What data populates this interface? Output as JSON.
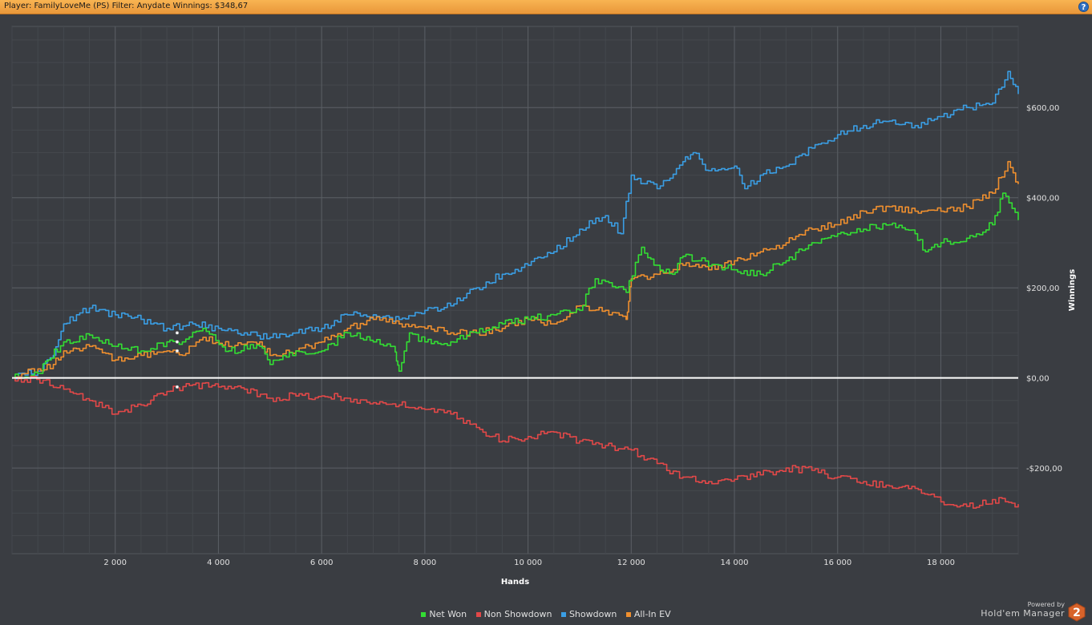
{
  "titlebar": {
    "text": "Player: FamilyLoveMe (PS) Filter: Anydate Winnings: $348,67",
    "help_label": "?"
  },
  "branding": {
    "powered_by": "Powered by",
    "product": "Hold'em Manager",
    "logo_label": "2"
  },
  "colors": {
    "background": "#3a3d42",
    "titlebar": "#f0a445",
    "grid": "#52565c",
    "zero_line": "#ffffff",
    "net_won": "#33dd33",
    "non_showdown": "#e24848",
    "showdown": "#3a9ee4",
    "all_in_ev": "#ef8f2e"
  },
  "chart_data": {
    "type": "line",
    "xlabel": "Hands",
    "ylabel": "Winnings",
    "xlim": [
      0,
      19500
    ],
    "ylim": [
      -390,
      780
    ],
    "x_ticks": [
      2000,
      4000,
      6000,
      8000,
      10000,
      12000,
      14000,
      16000,
      18000
    ],
    "x_tick_labels": [
      "2 000",
      "4 000",
      "6 000",
      "8 000",
      "10 000",
      "12 000",
      "14 000",
      "16 000",
      "18 000"
    ],
    "y_ticks": [
      -200,
      0,
      200,
      400,
      600
    ],
    "y_tick_labels": [
      "-$200,00",
      "$0,00",
      "$200,00",
      "$400,00",
      "$600,00"
    ],
    "grid": true,
    "legend_position": "bottom-center",
    "series": [
      {
        "name": "Net Won",
        "color": "#33dd33",
        "x": [
          0,
          500,
          700,
          1000,
          1500,
          2000,
          2500,
          3000,
          3300,
          3700,
          4200,
          4800,
          5000,
          5500,
          6000,
          6500,
          7000,
          7400,
          7500,
          7700,
          8000,
          8500,
          9000,
          9500,
          10000,
          10500,
          11000,
          11300,
          11700,
          11900,
          12200,
          12500,
          12800,
          13000,
          13300,
          13700,
          14000,
          14500,
          15000,
          15500,
          16000,
          16500,
          17000,
          17500,
          17700,
          18000,
          18500,
          19000,
          19200,
          19500
        ],
        "y": [
          0,
          10,
          40,
          80,
          95,
          70,
          60,
          80,
          80,
          110,
          60,
          70,
          30,
          60,
          60,
          100,
          80,
          70,
          15,
          100,
          80,
          80,
          100,
          120,
          130,
          140,
          150,
          220,
          200,
          190,
          290,
          250,
          230,
          270,
          260,
          250,
          240,
          230,
          260,
          300,
          320,
          330,
          340,
          320,
          280,
          300,
          310,
          340,
          410,
          350
        ]
      },
      {
        "name": "Non Showdown",
        "color": "#e24848",
        "x": [
          0,
          600,
          1000,
          1500,
          2000,
          2500,
          3000,
          3500,
          4000,
          4500,
          5000,
          5500,
          6000,
          6500,
          7000,
          7500,
          8000,
          8500,
          9000,
          9500,
          10000,
          10500,
          11000,
          11500,
          12000,
          12500,
          13000,
          13500,
          14000,
          14500,
          15000,
          15500,
          16000,
          16500,
          17000,
          17500,
          18000,
          18500,
          19000,
          19500
        ],
        "y": [
          0,
          -5,
          -25,
          -50,
          -80,
          -60,
          -30,
          -15,
          -20,
          -25,
          -45,
          -40,
          -40,
          -45,
          -55,
          -60,
          -70,
          -80,
          -110,
          -140,
          -130,
          -120,
          -140,
          -150,
          -160,
          -190,
          -220,
          -230,
          -225,
          -215,
          -200,
          -205,
          -220,
          -230,
          -240,
          -245,
          -275,
          -285,
          -270,
          -280
        ]
      },
      {
        "name": "Showdown",
        "color": "#3a9ee4",
        "x": [
          0,
          500,
          800,
          1000,
          1500,
          2000,
          2500,
          3000,
          3500,
          4000,
          4500,
          5000,
          5500,
          6000,
          6500,
          7000,
          7500,
          8000,
          8500,
          9000,
          9500,
          10000,
          10500,
          11000,
          11500,
          11800,
          12000,
          12500,
          13000,
          13200,
          13500,
          14000,
          14200,
          14500,
          15000,
          15500,
          16000,
          16500,
          17000,
          17500,
          18000,
          18500,
          19000,
          19300,
          19500
        ],
        "y": [
          0,
          15,
          50,
          120,
          155,
          140,
          130,
          110,
          120,
          110,
          100,
          90,
          100,
          110,
          140,
          140,
          130,
          150,
          160,
          200,
          230,
          250,
          280,
          330,
          360,
          320,
          450,
          420,
          480,
          500,
          460,
          470,
          420,
          450,
          470,
          510,
          540,
          560,
          570,
          560,
          580,
          600,
          610,
          680,
          630
        ]
      },
      {
        "name": "All-In EV",
        "color": "#ef8f2e",
        "x": [
          0,
          500,
          800,
          1000,
          1500,
          2000,
          2500,
          3000,
          3300,
          3700,
          4200,
          4800,
          5000,
          5500,
          6000,
          6500,
          7000,
          7500,
          8000,
          8500,
          9000,
          9500,
          10000,
          10500,
          11000,
          11500,
          11900,
          12000,
          12500,
          13000,
          13500,
          14000,
          14500,
          15000,
          15500,
          16000,
          16500,
          17000,
          17500,
          18000,
          18500,
          19000,
          19300,
          19500
        ],
        "y": [
          0,
          20,
          30,
          60,
          70,
          40,
          50,
          60,
          50,
          90,
          70,
          80,
          50,
          60,
          80,
          110,
          130,
          120,
          110,
          100,
          100,
          110,
          130,
          120,
          160,
          150,
          130,
          220,
          230,
          250,
          240,
          260,
          280,
          300,
          330,
          340,
          370,
          380,
          370,
          370,
          380,
          410,
          480,
          430
        ]
      }
    ],
    "markers": [
      {
        "series": "Showdown",
        "x": 3200,
        "y": 100
      },
      {
        "series": "Net Won",
        "x": 3200,
        "y": 80
      },
      {
        "series": "All-In EV",
        "x": 3200,
        "y": 60
      },
      {
        "series": "Non Showdown",
        "x": 3200,
        "y": -20
      }
    ]
  }
}
